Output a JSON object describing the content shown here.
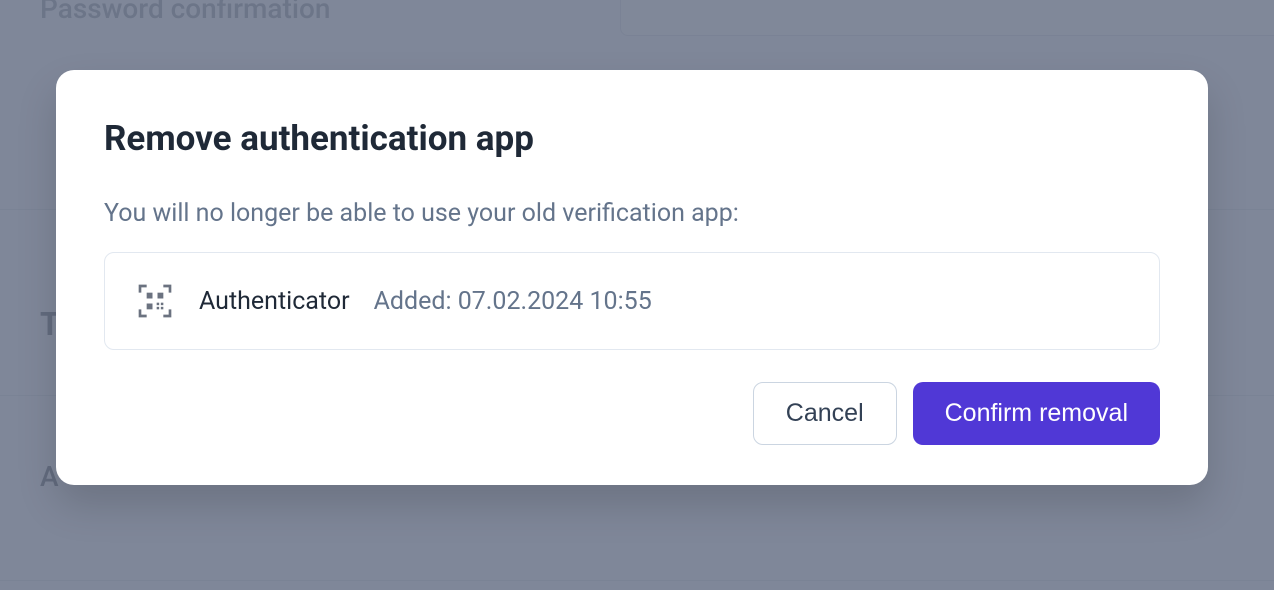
{
  "background": {
    "password_confirmation_label": "Password confirmation",
    "letter_t": "T",
    "letter_a": "A"
  },
  "modal": {
    "title": "Remove authentication app",
    "subtitle": "You will no longer be able to use your old verification app:",
    "authenticator": {
      "name": "Authenticator",
      "added_label": "Added: 07.02.2024 10:55"
    },
    "actions": {
      "cancel_label": "Cancel",
      "confirm_label": "Confirm removal"
    }
  }
}
